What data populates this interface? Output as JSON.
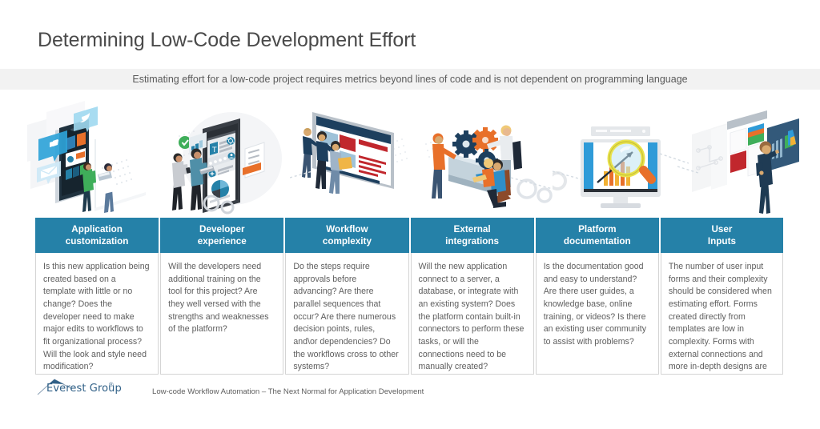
{
  "title": "Determining Low-Code Development Effort",
  "subtitle": "Estimating effort for a low-code project requires metrics beyond lines of code and is not dependent on programming language",
  "colors": {
    "header_blue": "#2581a8",
    "band_gray": "#f2f2f2",
    "body_text": "#5e5e5e",
    "title_text": "#4a4a4a",
    "logo_blue": "#2f5f86",
    "accent_orange": "#e8702a",
    "accent_red": "#c1272d"
  },
  "illustrations": [
    {
      "name": "mobile-app-icons-illustration",
      "alt": "Isometric smartphone with floating app icons and two people"
    },
    {
      "name": "developer-tablet-illustration",
      "alt": "Two people with laptop beside a large mobile UI panel with gears"
    },
    {
      "name": "workflow-screen-illustration",
      "alt": "Three people at a large wall display with content tiles"
    },
    {
      "name": "gears-team-illustration",
      "alt": "Team working around a machine with interlocking gears"
    },
    {
      "name": "monitor-magnifier-illustration",
      "alt": "Desktop monitor showing bar chart under a magnifying glass"
    },
    {
      "name": "dashboard-person-illustration",
      "alt": "Person interacting with dashboard panels and charts"
    }
  ],
  "table": {
    "columns": [
      {
        "header_line1": "Application",
        "header_line2": "customization",
        "body": "Is this new application being created based on a template with little or no change? Does the developer need to make major edits to workflows to fit organizational process? Will the look and style need modification?"
      },
      {
        "header_line1": "Developer",
        "header_line2": "experience",
        "body": "Will the developers need additional training on the tool for this project? Are they well versed with the strengths and weaknesses of the platform?"
      },
      {
        "header_line1": "Workflow",
        "header_line2": "complexity",
        "body": "Do the steps require approvals before advancing? Are there parallel sequences that occur? Are there numerous decision points, rules, and\\or dependencies? Do the workflows cross to other systems?"
      },
      {
        "header_line1": "External",
        "header_line2": "integrations",
        "body": "Will the new application connect to a server, a database, or integrate with an existing system? Does the platform contain built-in connectors to perform these tasks, or will the connections need to be manually created?"
      },
      {
        "header_line1": "Platform",
        "header_line2": "documentation",
        "body": "Is the documentation good and easy to understand? Are there user guides, a knowledge base, online training, or videos? Is there an existing user community to assist with problems?"
      },
      {
        "header_line1": "User",
        "header_line2": "Inputs",
        "body": "The number of user input forms and their complexity should be considered when estimating effort. Forms created directly from templates are low in complexity. Forms with external connections and more in-depth designs are highly complex."
      }
    ]
  },
  "footer": {
    "logo_text": "Everest Group",
    "logo_registered": "®",
    "caption": "Low-code Workflow Automation – The Next Normal for Application Development"
  }
}
